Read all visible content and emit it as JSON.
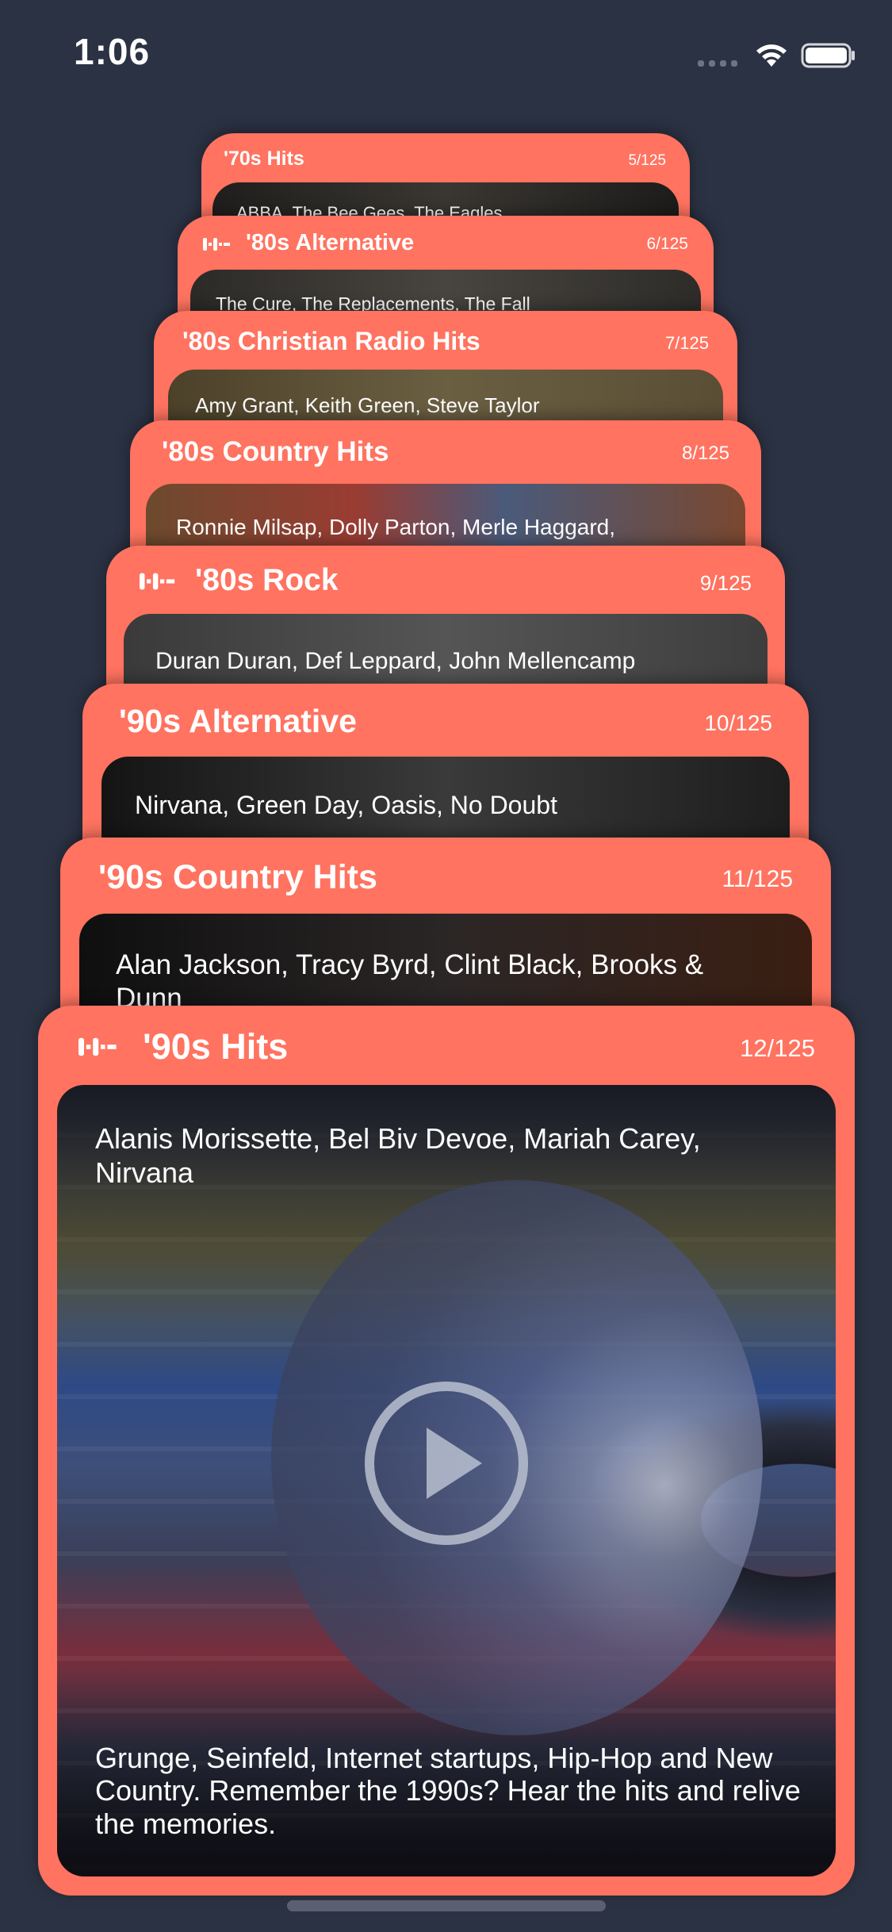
{
  "status_bar": {
    "time": "1:06"
  },
  "cards": [
    {
      "title": "'70s Hits",
      "count": "5/125",
      "artists": "ABBA, The Bee Gees, The Eagles"
    },
    {
      "title": "'80s Alternative",
      "count": "6/125",
      "artists": "The Cure, The Replacements, The Fall"
    },
    {
      "title": "'80s Christian Radio Hits",
      "count": "7/125",
      "artists": "Amy Grant, Keith Green, Steve Taylor"
    },
    {
      "title": "'80s Country Hits",
      "count": "8/125",
      "artists": "Ronnie Milsap, Dolly Parton, Merle Haggard,"
    },
    {
      "title": "'80s Rock",
      "count": "9/125",
      "artists": "Duran Duran, Def Leppard, John Mellencamp"
    },
    {
      "title": "'90s Alternative",
      "count": "10/125",
      "artists": "Nirvana, Green Day, Oasis, No Doubt"
    },
    {
      "title": "'90s Country Hits",
      "count": "11/125",
      "artists": "Alan Jackson, Tracy Byrd, Clint Black, Brooks & Dunn"
    },
    {
      "title": "'90s Hits",
      "count": "12/125",
      "artists": "Alanis Morissette, Bel Biv Devoe, Mariah Carey, Nirvana",
      "description": "Grunge, Seinfeld, Internet startups, Hip-Hop and New Country. Remember the 1990s? Hear the hits and relive the memories."
    }
  ],
  "icons": {
    "logo": "station-logo-icon",
    "play": "play-icon",
    "wifi": "wifi-icon",
    "battery": "battery-icon",
    "signal": "cellular-signal-icon"
  },
  "colors": {
    "background": "#2b3243",
    "card": "#ff7360"
  }
}
